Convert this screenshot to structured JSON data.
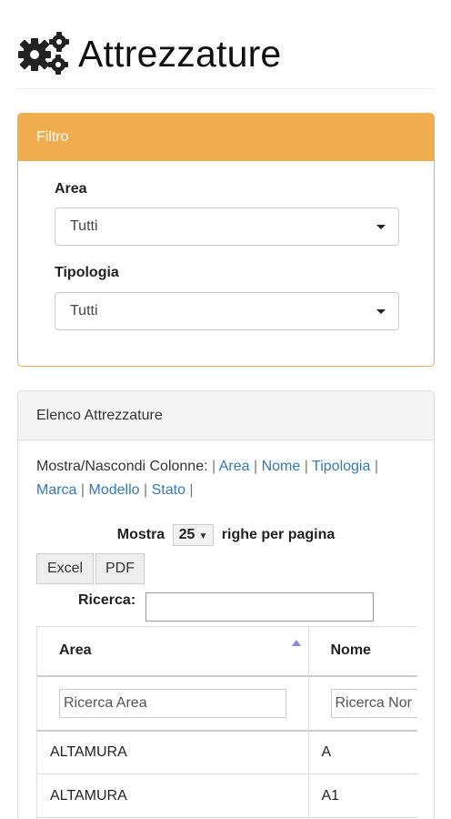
{
  "header": {
    "title": "Attrezzature",
    "icon": "gears-icon"
  },
  "filter_panel": {
    "title": "Filtro",
    "accent_color": "#f0ad4e",
    "area": {
      "label": "Area",
      "selected": "Tutti"
    },
    "tipologia": {
      "label": "Tipologia",
      "selected": "Tutti"
    }
  },
  "list_panel": {
    "title": "Elenco Attrezzature",
    "colvis": {
      "prefix": "Mostra/Nascondi Colonne:",
      "links": [
        "Area",
        "Nome",
        "Tipologia",
        "Marca",
        "Modello",
        "Stato"
      ],
      "separator": "|"
    },
    "length": {
      "before": "Mostra",
      "value": "25",
      "after": "righe per pagina"
    },
    "buttons": {
      "excel": "Excel",
      "pdf": "PDF"
    },
    "search": {
      "label": "Ricerca:",
      "value": ""
    },
    "table": {
      "headers": [
        "Area",
        "Nome"
      ],
      "filters": [
        "Ricerca Area",
        "Ricerca Nor"
      ],
      "rows": [
        [
          "ALTAMURA",
          "A"
        ],
        [
          "ALTAMURA",
          "A1"
        ]
      ]
    }
  }
}
